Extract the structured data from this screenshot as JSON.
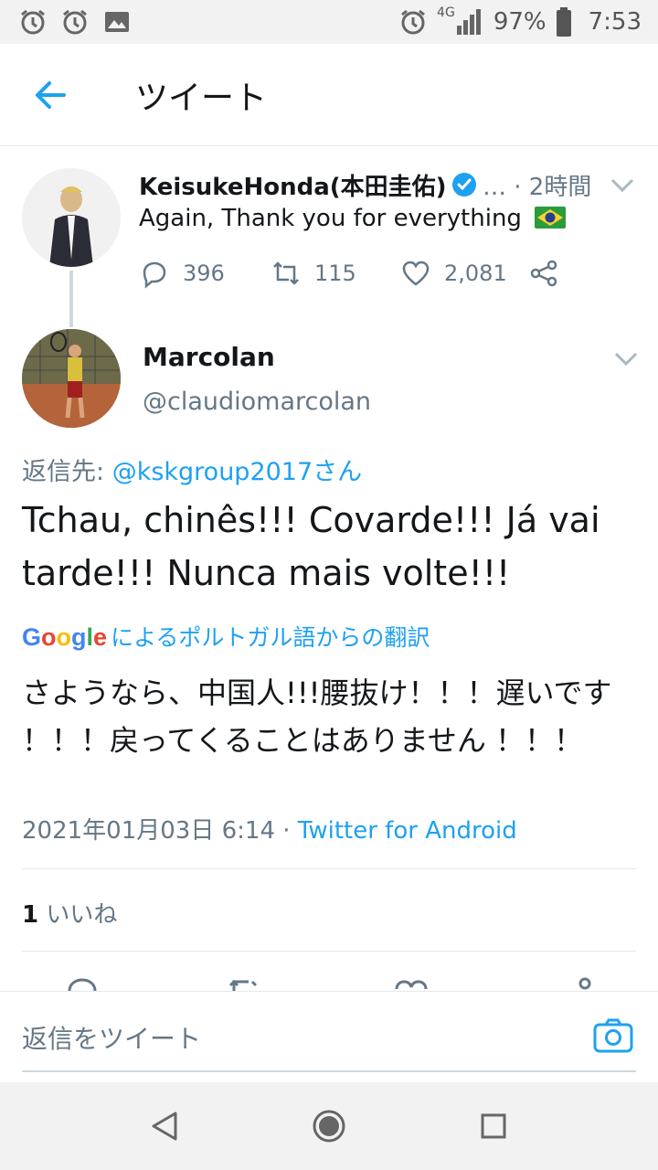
{
  "status_bar": {
    "network": "4G",
    "battery": "97%",
    "time": "7:53"
  },
  "header": {
    "title": "ツイート"
  },
  "parent_tweet": {
    "author_name": "KeisukeHonda(本田圭佑)",
    "meta": "… · 2時間",
    "text": "Again, Thank you for everything",
    "replies": "396",
    "retweets": "115",
    "likes": "2,081"
  },
  "reply_tweet": {
    "author_name": "Marcolan",
    "handle": "@claudiomarcolan",
    "reply_to_prefix": "返信先: ",
    "reply_to_mention": "@kskgroup2017さん",
    "text": "Tchau, chinês!!! Covarde!!! Já vai tarde!!! Nunca mais volte!!!",
    "translation_brand": "Google",
    "translation_label": "によるポルトガル語からの翻訳",
    "translated_text": "さようなら、中国人!!!腰抜け！！！遅いです ！！！戻ってくることはありません ！！！",
    "timestamp": "2021年01月03日 6:14 · ",
    "source": "Twitter for Android",
    "like_count": "1",
    "like_label": " いいね"
  },
  "reply_bar": {
    "placeholder": "返信をツイート"
  },
  "colors": {
    "accent": "#1da1f2",
    "secondary_text": "#657786"
  }
}
